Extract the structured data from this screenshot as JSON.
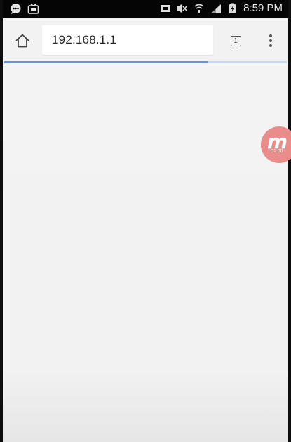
{
  "status_bar": {
    "time": "8:59 PM",
    "left_icons": [
      "chat-bubble-icon",
      "cast-icon"
    ],
    "right_icons": [
      "screenshot-icon",
      "mute-icon",
      "wifi-icon",
      "signal-icon",
      "battery-icon"
    ]
  },
  "browser": {
    "address": "192.168.1.1",
    "tab_count": "1",
    "load_progress": 0.72,
    "accent_color": "#6b93d6"
  },
  "overlay": {
    "recorder_letter": "m",
    "recorder_sub": "01:00",
    "color": "#ea8c8a"
  }
}
